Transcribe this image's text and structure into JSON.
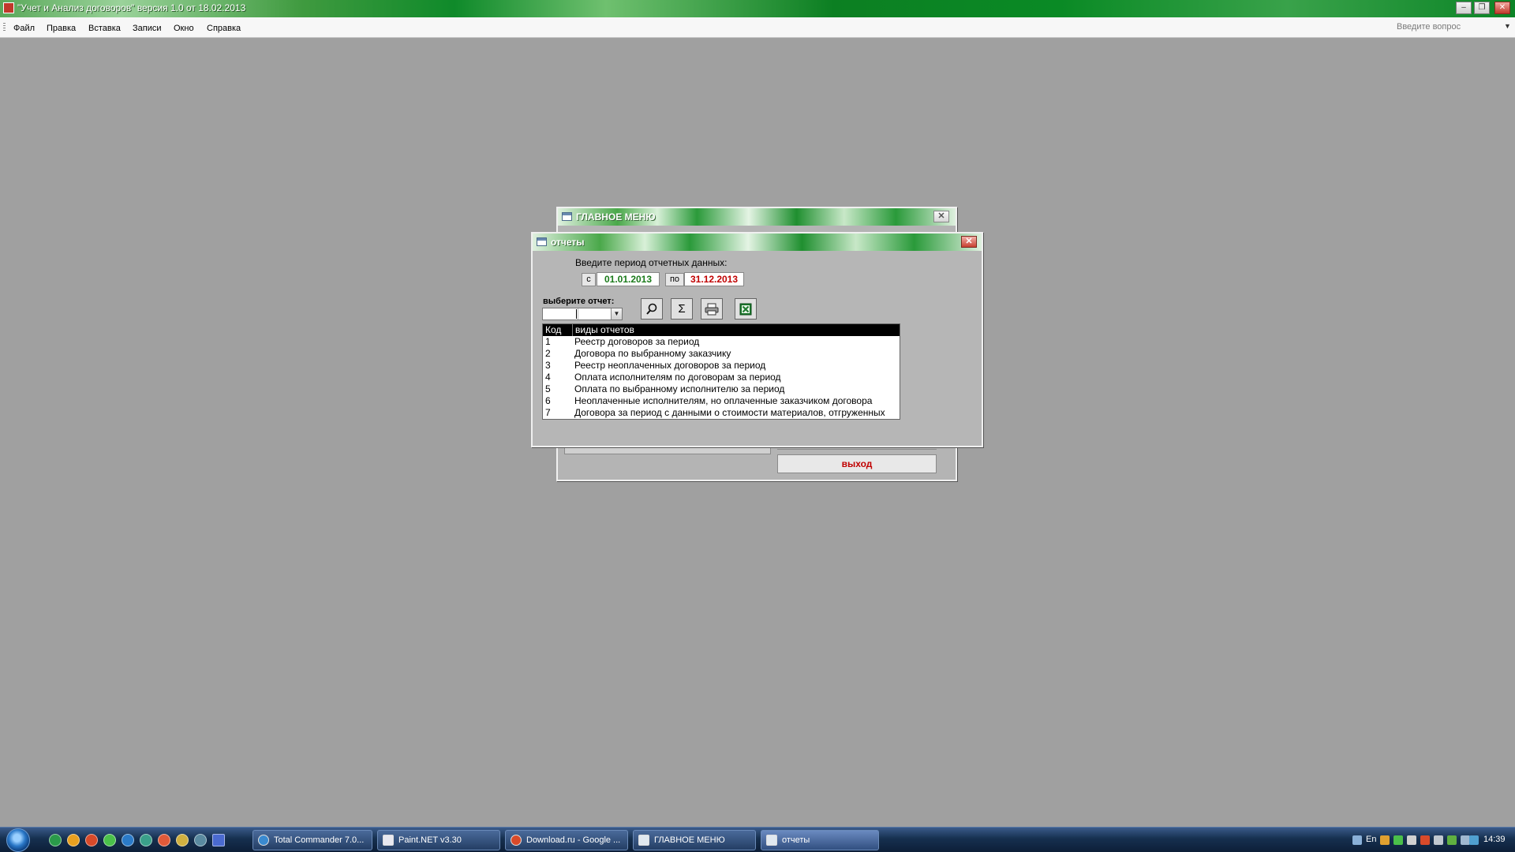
{
  "app": {
    "title": "\"Учет и Анализ договоров\" версия 1.0 от 18.02.2013"
  },
  "menubar": {
    "items": [
      "Файл",
      "Правка",
      "Вставка",
      "Записи",
      "Окно",
      "Справка"
    ],
    "help_placeholder": "Введите вопрос"
  },
  "main_menu_window": {
    "title": "ГЛАВНОЕ МЕНЮ",
    "exit_label": "выход"
  },
  "reports_window": {
    "title": "отчеты",
    "period_prompt": "Введите период отчетных данных:",
    "from_label": "с",
    "from_date": "01.01.2013",
    "to_label": "по",
    "to_date": "31.12.2013",
    "select_label": "выберите отчет:",
    "toolbar_icons": [
      "search-icon",
      "sum-icon",
      "print-icon",
      "excel-icon"
    ],
    "list": {
      "columns": [
        "Код",
        "виды отчетов"
      ],
      "rows": [
        [
          "1",
          "Реестр договоров за период"
        ],
        [
          "2",
          "Договора по выбранному заказчику"
        ],
        [
          "3",
          "Реестр неоплаченных договоров за период"
        ],
        [
          "4",
          "Оплата исполнителям по договорам за период"
        ],
        [
          "5",
          "Оплата по выбранному исполнителю за период"
        ],
        [
          "6",
          "Неоплаченные исполнителям, но оплаченные заказчиком договора"
        ],
        [
          "7",
          "Договора за период с данными о стоимости материалов, отгруженных"
        ]
      ]
    }
  },
  "taskbar": {
    "buttons": [
      "Total Commander 7.0...",
      "Paint.NET v3.30",
      "Download.ru - Google ...",
      "ГЛАВНОЕ МЕНЮ",
      "отчеты"
    ],
    "lang": "En",
    "clock": "14:39"
  },
  "colors": {
    "from_date": "#1a7a1a",
    "to_date": "#c00000",
    "exit": "#c00000"
  }
}
